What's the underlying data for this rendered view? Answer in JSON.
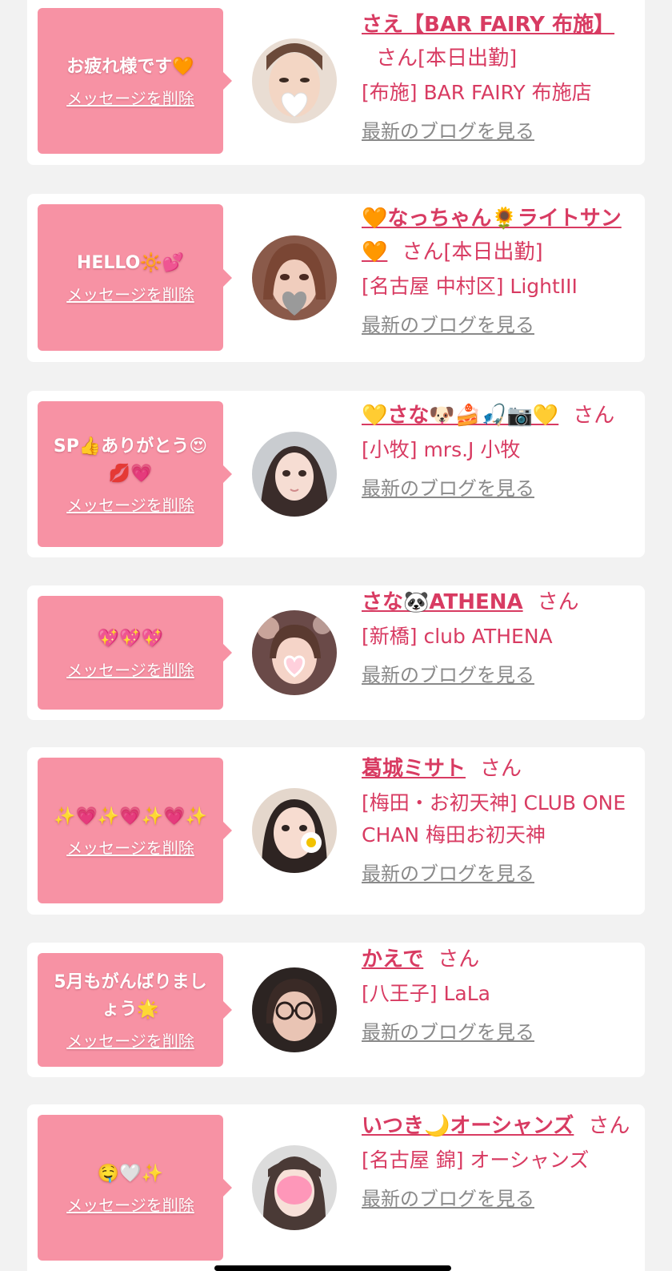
{
  "colors": {
    "bubble": "#f792a4",
    "accent": "#d83b62",
    "link_gray": "#8a8a8a",
    "page_bg": "#f2f2f2"
  },
  "delete_label": "メッセージを削除",
  "blog_label": "最新のブログを見る",
  "san_label": "さん",
  "cards": [
    {
      "message": "お疲れ様です🧡",
      "name": "さえ【BAR FAIRY 布施】",
      "shift": "[本日出勤]",
      "shop": "[布施] BAR FAIRY 布施店",
      "avatar": "avatar-photo-woman-heart-sticker"
    },
    {
      "message": "HELLO🔆💕",
      "name": "🧡なっちゃん🌻ライトサン🧡",
      "shift": "[本日出勤]",
      "shop": "[名古屋 中村区] LightIII",
      "avatar": "avatar-photo-woman-gray-heart"
    },
    {
      "message": "SP👍ありがとう😍💋💗",
      "name": "💛さな🐶🍰🎣📷💛",
      "shift": "",
      "shop": "[小牧] mrs.J 小牧",
      "avatar": "avatar-photo-woman"
    },
    {
      "message": "💖💖💖",
      "name": "さな🐼ATHENA",
      "shift": "",
      "shop": "[新橋] club ATHENA",
      "avatar": "avatar-photo-woman-heart-sticker"
    },
    {
      "message": "✨💗✨💗✨💗✨",
      "name": "葛城ミサト",
      "shift": "",
      "shop": "[梅田・お初天神] CLUB ONE CHAN 梅田お初天神",
      "avatar": "avatar-photo-woman-flower-sticker"
    },
    {
      "message": "5月もがんばりましょう🌟",
      "name": "かえで",
      "shift": "",
      "shop": "[八王子] LaLa",
      "avatar": "avatar-photo-woman-glasses"
    },
    {
      "message": "🤤🤍✨",
      "name": "いつき🌙オーシャンズ",
      "shift": "",
      "shop": "[名古屋 錦] オーシャンズ",
      "avatar": "avatar-photo-woman-pink-sticker"
    }
  ]
}
